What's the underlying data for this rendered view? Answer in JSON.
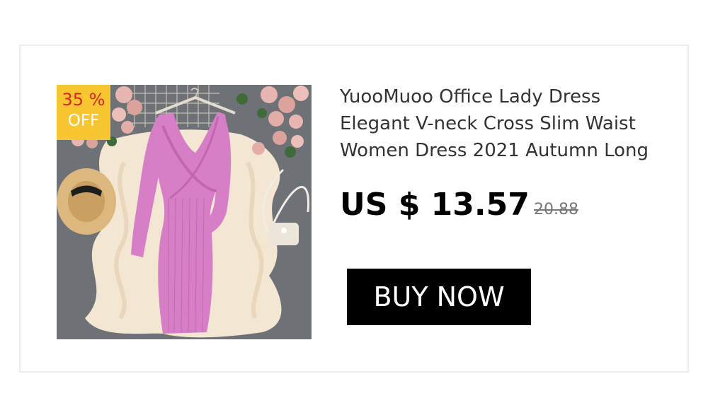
{
  "badge": {
    "percent": "35 %",
    "off": "OFF",
    "color": "#f7c631",
    "percent_color": "#d6281f"
  },
  "product": {
    "title": "YuooMuoo Office Lady Dress Elegant V-neck Cross Slim Waist Women Dress 2021 Autumn Long",
    "price": "US $ 13.57",
    "original_price": "20.88",
    "dress_color": "#d77fc6"
  },
  "buy_button": {
    "label": "BUY NOW"
  }
}
